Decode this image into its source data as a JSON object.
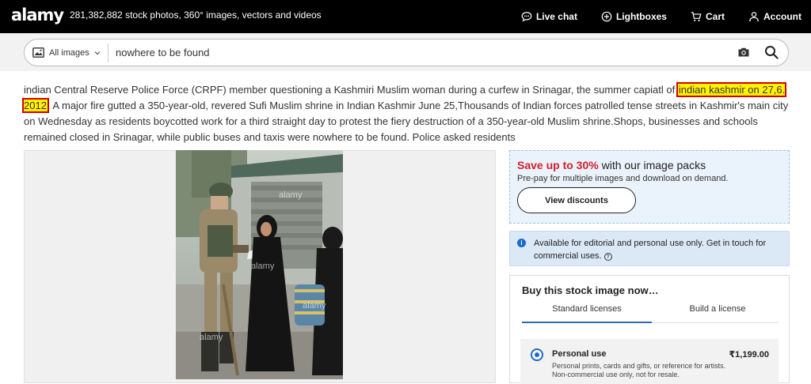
{
  "header": {
    "logo": "alamy",
    "tagline": "281,382,882 stock photos, 360° images, vectors and videos",
    "nav": {
      "live_chat": "Live chat",
      "lightboxes": "Lightboxes",
      "cart": "Cart",
      "account": "Account"
    }
  },
  "search": {
    "filter_label": "All images",
    "query": "nowhere to be found"
  },
  "description": {
    "before": "indian Central Reserve Police Force (CRPF) member questioning a Kashmiri Muslim woman during a curfew in Srinagar, the summer capiatl of ",
    "highlight": "indian kashmir on 27,6. 2012",
    "after": ". A major fire gutted a 350-year-old, revered Sufi Muslim shrine in Indian Kashmir June 25,Thousands of Indian forces patrolled tense streets in Kashmir's main city on Wednesday as residents boycotted work for a third straight day to protest the fiery destruction of a 350-year-old Muslim shrine.Shops, businesses and schools remained closed in Srinagar, while public buses and taxis were nowhere to be found. Police asked residents"
  },
  "photo": {
    "watermark": "alamy"
  },
  "promo": {
    "highlight": "Save up to 30%",
    "headline_rest": " with our image packs",
    "subtext": "Pre-pay for multiple images and download on demand.",
    "button": "View discounts"
  },
  "info": {
    "text": "Available for editorial and personal use only. Get in touch for commercial uses."
  },
  "buy": {
    "title": "Buy this stock image now…",
    "tabs": [
      "Standard licenses",
      "Build a license"
    ],
    "option": {
      "name": "Personal use",
      "price": "₹1,199.00",
      "description": "Personal prints, cards and gifts, or reference for artists. Non-commercial use only, not for resale."
    }
  },
  "colors": {
    "header_bg": "#000000",
    "promo_red": "#d5202c",
    "accent_blue": "#1a6bc9",
    "highlight_yellow": "#fff200"
  }
}
